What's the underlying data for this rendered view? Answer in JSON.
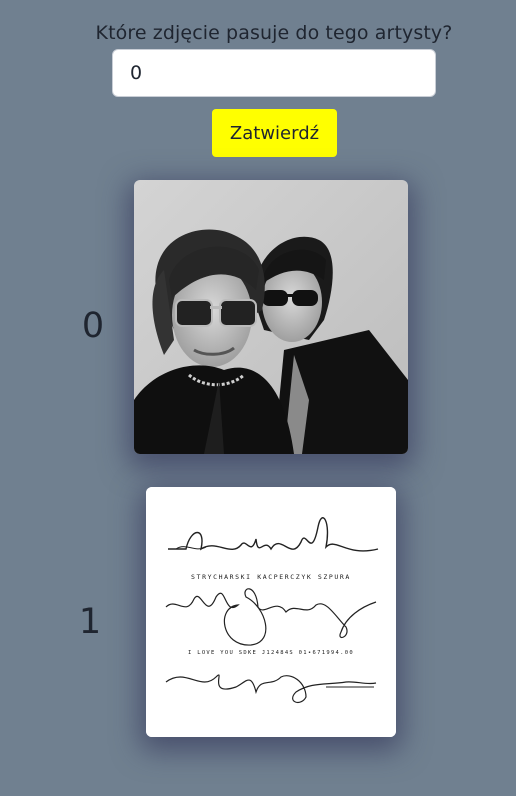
{
  "quiz": {
    "question": "Które zdjęcie pasuje do tego artysty?",
    "answer_value": "0",
    "submit_label": "Zatwierdź"
  },
  "options": [
    {
      "label": "0",
      "image": "black-and-white-photo-of-two-people-in-sunglasses"
    },
    {
      "label": "1",
      "image": "signature-artwork-with-text"
    }
  ],
  "signature_art": {
    "line1": "STRYCHARSKI KACPERCZYK SZPURA",
    "line2": "I LOVE YOU SDKE J12484S 01•671994.00"
  },
  "colors": {
    "background": "#708090",
    "button": "#ffff00",
    "text": "#1f2530"
  }
}
